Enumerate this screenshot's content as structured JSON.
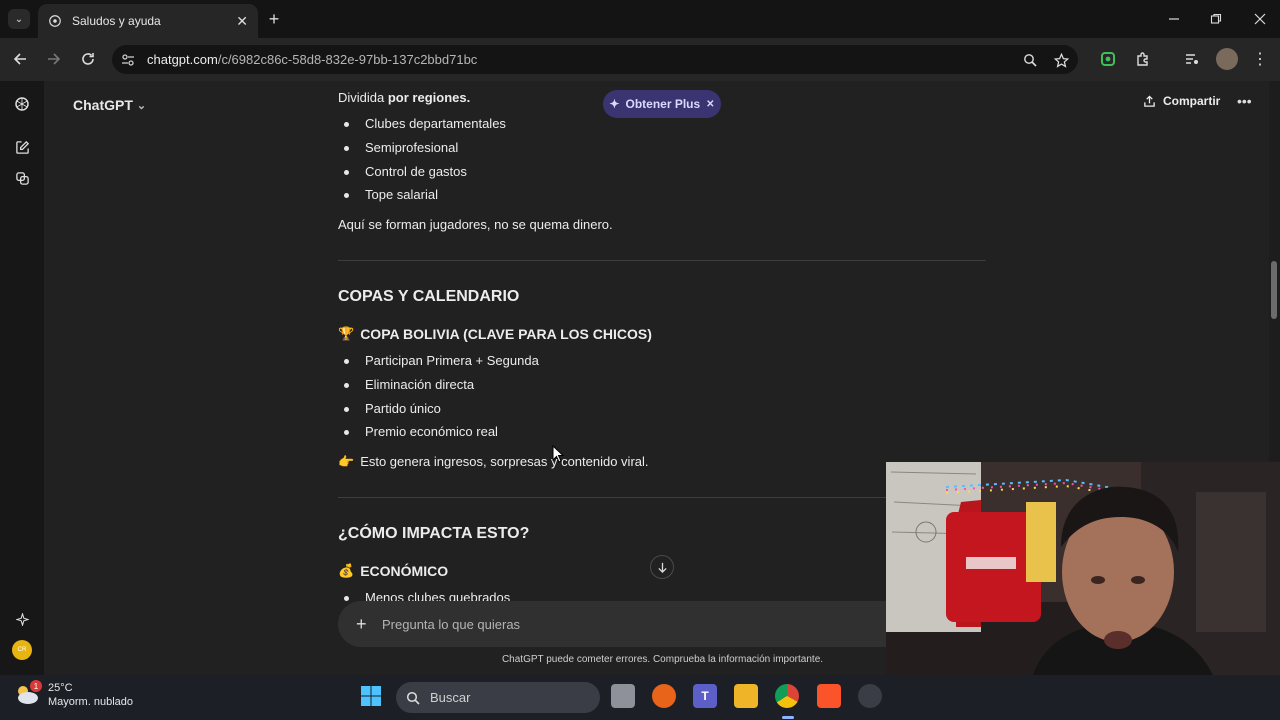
{
  "browser": {
    "tab_title": "Saludos y ayuda",
    "url_host": "chatgpt.com",
    "url_path": "/c/6982c86c-58d8-832e-97bb-137c2bbd71bc",
    "new_tab_symbol": "+",
    "close_symbol": "✕"
  },
  "app": {
    "title": "ChatGPT",
    "plus_label": "Obtener Plus",
    "share_label": "Compartir",
    "accent": "#3a3470"
  },
  "sidebar": {
    "icons": [
      "openai-logo-icon",
      "new-chat-icon",
      "library-icon",
      "sparkle-icon",
      "avatar"
    ],
    "avatar_initials": "CR"
  },
  "content": {
    "intro_prefix": "Dividida ",
    "intro_bold": "por regiones.",
    "list1": [
      "Clubes departamentales",
      "Semiprofesional",
      "Control de gastos",
      "Tope salarial"
    ],
    "para1": "Aquí se forman jugadores, no se quema dinero.",
    "h_copas": "COPAS Y CALENDARIO",
    "h_copa_bolivia_emoji": "🏆",
    "h_copa_bolivia": "COPA BOLIVIA (CLAVE PARA LOS CHICOS)",
    "list2": [
      "Participan Primera + Segunda",
      "Eliminación directa",
      "Partido único",
      "Premio económico real"
    ],
    "para2_emoji": "👉",
    "para2": "Esto genera ingresos, sorpresas y contenido viral.",
    "h_impacto": "¿CÓMO IMPACTA ESTO?",
    "h_economico_emoji": "💰",
    "h_economico": "ECONÓMICO",
    "list3": [
      "Menos clubes quebrados"
    ]
  },
  "composer": {
    "placeholder": "Pregunta lo que quieras"
  },
  "disclaimer": "ChatGPT puede cometer errores. Comprueba la información importante.",
  "taskbar": {
    "temp": "25°C",
    "weather": "Mayorm. nublado",
    "weather_badge": "1",
    "search_label": "Buscar"
  }
}
